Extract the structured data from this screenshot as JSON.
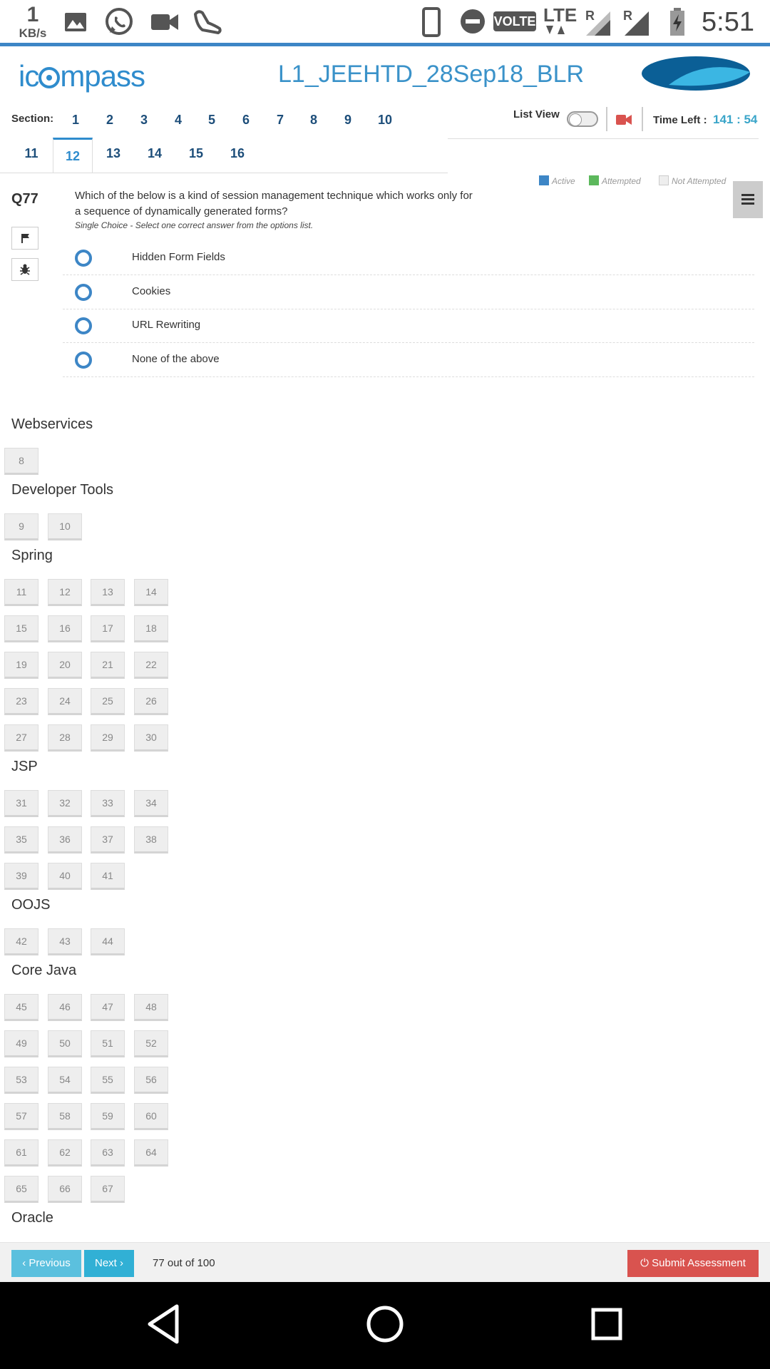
{
  "status_bar": {
    "net_speed": "1",
    "net_unit": "KB/s",
    "volte": "VOLTE",
    "lte": "LTE",
    "roaming_1": "R",
    "roaming_2": "R",
    "time": "5:51",
    "icons": [
      "image-icon",
      "whatsapp-icon",
      "video-icon",
      "shoe-icon",
      "phone-icon",
      "dnd-icon",
      "signal-icon",
      "signal-icon",
      "battery-charging-icon"
    ]
  },
  "header": {
    "logo_prefix": "i",
    "logo_suffix": "mpass",
    "logo_c": "c",
    "test_title": "L1_JEEHTD_28Sep18_BLR"
  },
  "sections": {
    "label": "Section:",
    "row1": [
      "1",
      "2",
      "3",
      "4",
      "5",
      "6",
      "7",
      "8",
      "9",
      "10"
    ],
    "row2": [
      "11",
      "12",
      "13",
      "14",
      "15",
      "16"
    ],
    "active": "12"
  },
  "toolbar": {
    "list_view_label": "List View",
    "time_left_label": "Time Left :",
    "time_left_value": "141 : 54"
  },
  "legend": {
    "active": "Active",
    "attempted": "Attempted",
    "not_attempted": "Not Attempted",
    "colors": {
      "active": "#3d86c6",
      "attempted": "#5cb85c",
      "not_attempted": "#eeeeee"
    }
  },
  "question": {
    "number": "Q77",
    "text_line1": "Which of the below is a kind of  session management technique which works only for",
    "text_line2": "a sequence of dynamically generated forms?",
    "hint": "Single Choice - Select one correct answer from the options list.",
    "options": [
      "Hidden Form Fields",
      "Cookies",
      "URL Rewriting",
      "None of the above"
    ]
  },
  "palette": {
    "categories": [
      {
        "name": "Webservices",
        "rows": [
          [
            "8"
          ]
        ]
      },
      {
        "name": "Developer Tools",
        "rows": [
          [
            "9",
            "10"
          ]
        ]
      },
      {
        "name": "Spring",
        "rows": [
          [
            "11",
            "12",
            "13",
            "14"
          ],
          [
            "15",
            "16",
            "17",
            "18"
          ],
          [
            "19",
            "20",
            "21",
            "22"
          ],
          [
            "23",
            "24",
            "25",
            "26"
          ],
          [
            "27",
            "28",
            "29",
            "30"
          ]
        ]
      },
      {
        "name": "JSP",
        "rows": [
          [
            "31",
            "32",
            "33",
            "34"
          ],
          [
            "35",
            "36",
            "37",
            "38"
          ],
          [
            "39",
            "40",
            "41"
          ]
        ]
      },
      {
        "name": "OOJS",
        "rows": [
          [
            "42",
            "43",
            "44"
          ]
        ]
      },
      {
        "name": "Core Java",
        "rows": [
          [
            "45",
            "46",
            "47",
            "48"
          ],
          [
            "49",
            "50",
            "51",
            "52"
          ],
          [
            "53",
            "54",
            "55",
            "56"
          ],
          [
            "57",
            "58",
            "59",
            "60"
          ],
          [
            "61",
            "62",
            "63",
            "64"
          ],
          [
            "65",
            "66",
            "67"
          ]
        ]
      },
      {
        "name": "Oracle",
        "rows": []
      }
    ]
  },
  "footer": {
    "prev_label": "‹ Previous",
    "next_label": "Next ›",
    "progress_text": "77 out of 100",
    "submit_label": "⏻ Submit Assessment"
  },
  "accent_colors": {
    "brand_blue": "#2f8ccd",
    "timer": "#3aa5c9",
    "submit": "#d9534f",
    "nav_button": "#5bc0de"
  }
}
